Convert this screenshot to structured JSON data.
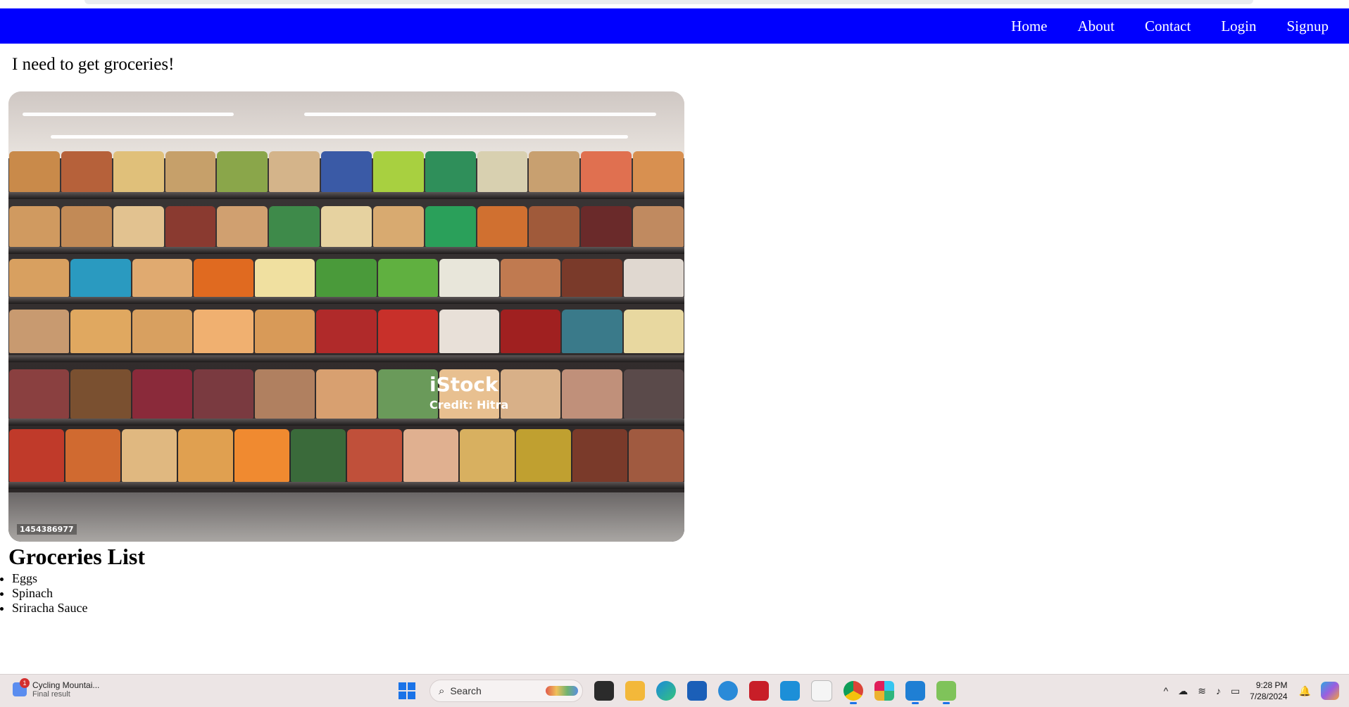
{
  "nav": {
    "links": [
      "Home",
      "About",
      "Contact",
      "Login",
      "Signup"
    ]
  },
  "intro_text": "I need to get groceries!",
  "image": {
    "watermark_logo": "iStock",
    "watermark_credit": "Credit: Hitra",
    "image_id": "1454386977"
  },
  "groceries": {
    "title": "Groceries List",
    "items": [
      "Eggs",
      "Spinach",
      "Sriracha Sauce"
    ]
  },
  "taskbar": {
    "notification_title": "Cycling Mountai...",
    "notification_subtitle": "Final result",
    "notification_badge": "1",
    "search_placeholder": "Search",
    "time": "9:28 PM",
    "date": "7/28/2024",
    "apps": [
      "file-explorer-icon",
      "edge-icon",
      "store-icon",
      "help-icon",
      "mcafee-icon",
      "myhp-icon",
      "notepad-icon",
      "chrome-icon",
      "slack-icon",
      "vscode-icon",
      "app-icon"
    ]
  },
  "colors": {
    "navbar": "#0000ff",
    "nav_text": "#ffffff"
  }
}
